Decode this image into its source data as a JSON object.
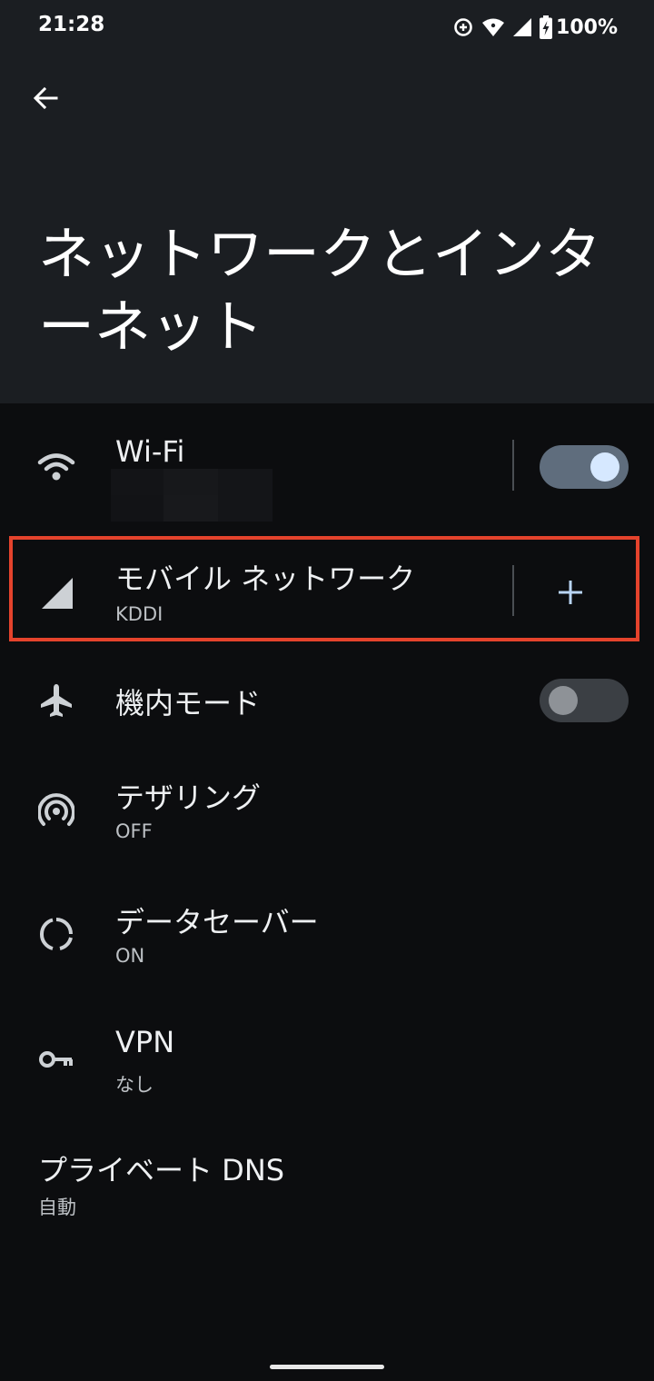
{
  "status_bar": {
    "time": "21:28",
    "battery": "100%",
    "icons": [
      "data-saver-icon",
      "wifi-signal-icon",
      "cell-signal-icon",
      "battery-charging-icon"
    ]
  },
  "header": {
    "back_icon": "arrow-left-icon",
    "title": "ネットワークとインターネット"
  },
  "items": {
    "wifi": {
      "title": "Wi-Fi",
      "toggle_on": true,
      "icon": "wifi-icon"
    },
    "mobile": {
      "title": "モバイル ネットワーク",
      "subtitle": "KDDI",
      "icon": "cell-signal-icon",
      "action_icon": "plus-icon"
    },
    "airplane": {
      "title": "機内モード",
      "toggle_on": false,
      "icon": "airplane-icon"
    },
    "tethering": {
      "title": "テザリング",
      "subtitle": "OFF",
      "icon": "hotspot-icon"
    },
    "data_saver": {
      "title": "データセーバー",
      "subtitle": "ON",
      "icon": "data-saver-icon"
    },
    "vpn": {
      "title": "VPN",
      "subtitle": "なし",
      "icon": "key-icon"
    },
    "private_dns": {
      "title": "プライベート DNS",
      "subtitle": "自動"
    }
  },
  "colors": {
    "header_bg": "#1b1e22",
    "body_bg": "#0c0d0f",
    "highlight": "#e5432c",
    "toggle_on_track": "#5f6d7d",
    "toggle_on_knob": "#d6e8ff"
  }
}
